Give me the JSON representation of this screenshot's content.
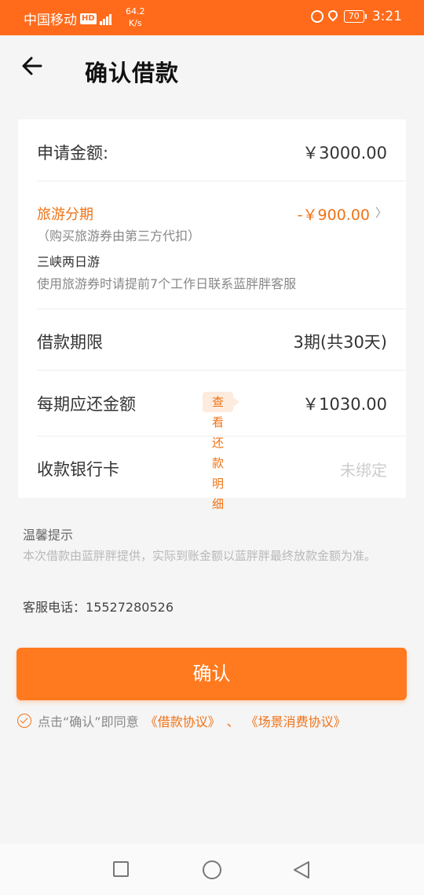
{
  "status_bar": {
    "carrier": "中国移动",
    "hd": "HD",
    "speed_value": "64.2",
    "speed_unit": "K/s",
    "battery": "70",
    "time": "3:21"
  },
  "header": {
    "title": "确认借款"
  },
  "loan": {
    "apply_label": "申请金额:",
    "apply_amount": "￥3000.00",
    "travel_title": "旅游分期",
    "travel_sub": "（购买旅游券由第三方代扣）",
    "travel_amount": "-￥900.00",
    "trip_name": "三峡两日游",
    "trip_note": "使用旅游券时请提前7个工作日联系蓝胖胖客服",
    "term_label": "借款期限",
    "term_value": "3期(共30天)",
    "repay_label": "每期应还金额",
    "repay_detail_button": "查看还款明细",
    "repay_amount": "￥1030.00",
    "card_label": "收款银行卡",
    "card_value": "未绑定"
  },
  "tips": {
    "title": "温馨提示",
    "body": "本次借款由蓝胖胖提供，实际到账金额以蓝胖胖最终放款金额为准。",
    "phone_label": "客服电话：",
    "phone_number": "15527280526"
  },
  "confirm_button": "确认",
  "agreement": {
    "prefix": "点击“确认”即同意",
    "link1": "《借款协议》",
    "separator": "、",
    "link2": "《场景消费协议》"
  },
  "colors": {
    "brand_orange": "#ff7a1f",
    "status_bar": "#ff6b1a",
    "accent_text": "#f07216"
  }
}
